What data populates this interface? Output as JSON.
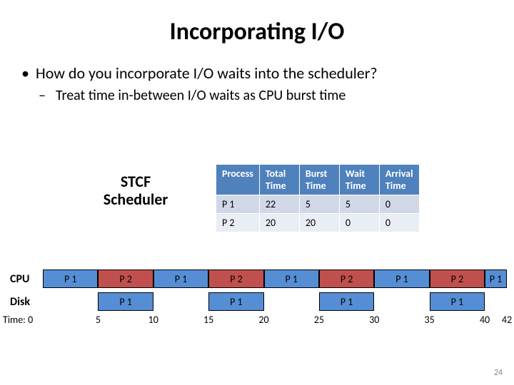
{
  "title": "Incorporating I/O",
  "bullet1": "How do you incorporate I/O waits into the scheduler?",
  "bullet2": "Treat time in-between I/O waits as CPU burst time",
  "scheduler_label_l1": "STCF",
  "scheduler_label_l2": "Scheduler",
  "table": {
    "headers": [
      "Process",
      "Total Time",
      "Burst Time",
      "Wait Time",
      "Arrival Time"
    ],
    "rows": [
      [
        "P 1",
        "22",
        "5",
        "5",
        "0"
      ],
      [
        "P 2",
        "20",
        "20",
        "0",
        "0"
      ]
    ]
  },
  "rows": {
    "cpu": "CPU",
    "disk": "Disk"
  },
  "timeline": {
    "label": "Time: 0",
    "ticks": [
      "5",
      "10",
      "15",
      "20",
      "25",
      "30",
      "35",
      "40",
      "42"
    ]
  },
  "page_number": "24",
  "chart_data": {
    "type": "gantt",
    "title": "STCF Scheduler with I/O bursts",
    "time_range": [
      0,
      42
    ],
    "rows": [
      {
        "name": "CPU",
        "segments": [
          {
            "process": "P 1",
            "start": 0,
            "end": 5
          },
          {
            "process": "P 2",
            "start": 5,
            "end": 10
          },
          {
            "process": "P 1",
            "start": 10,
            "end": 15
          },
          {
            "process": "P 2",
            "start": 15,
            "end": 20
          },
          {
            "process": "P 1",
            "start": 20,
            "end": 25
          },
          {
            "process": "P 2",
            "start": 25,
            "end": 30
          },
          {
            "process": "P 1",
            "start": 30,
            "end": 35
          },
          {
            "process": "P 2",
            "start": 35,
            "end": 40
          },
          {
            "process": "P 1",
            "start": 40,
            "end": 42
          }
        ]
      },
      {
        "name": "Disk",
        "segments": [
          {
            "process": "P 1",
            "start": 5,
            "end": 10
          },
          {
            "process": "P 1",
            "start": 15,
            "end": 20
          },
          {
            "process": "P 1",
            "start": 25,
            "end": 30
          },
          {
            "process": "P 1",
            "start": 35,
            "end": 40
          }
        ]
      }
    ],
    "ticks": [
      0,
      5,
      10,
      15,
      20,
      25,
      30,
      35,
      40,
      42
    ],
    "colors": {
      "P 1": "#558ed5",
      "P 2": "#c0504d"
    }
  }
}
